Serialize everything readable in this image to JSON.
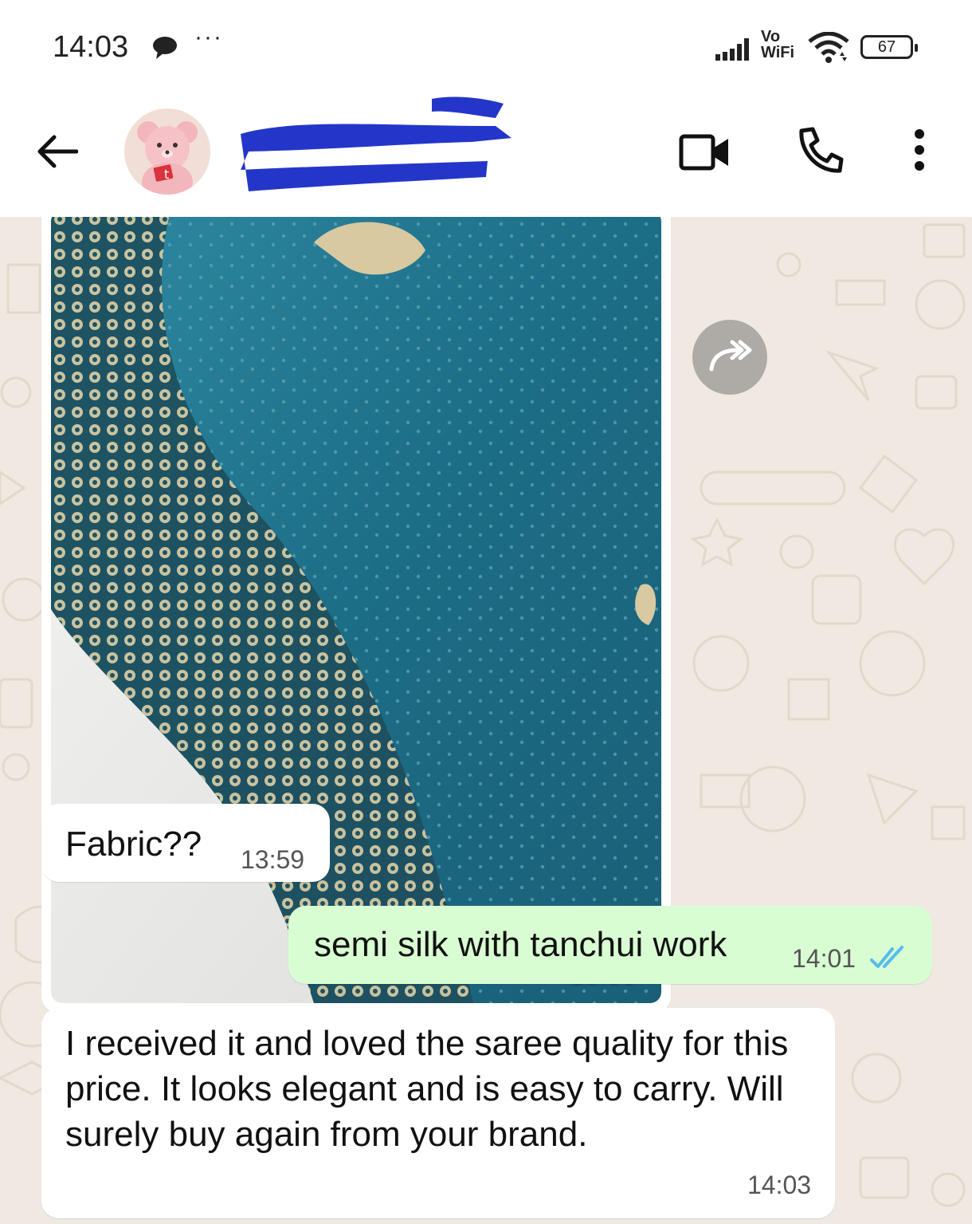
{
  "status_bar": {
    "time": "14:03",
    "more": "···",
    "network_label_top": "Vo",
    "network_label_bottom": "WiFi",
    "battery": "67"
  },
  "header": {
    "contact_name": "",
    "icons": [
      "back-arrow-icon",
      "video-call-icon",
      "phone-call-icon",
      "more-vert-icon"
    ]
  },
  "messages": [
    {
      "type": "image",
      "direction": "incoming",
      "time": "13:59"
    },
    {
      "type": "text",
      "direction": "incoming",
      "text": "Fabric??",
      "time": "13:59"
    },
    {
      "type": "text",
      "direction": "outgoing",
      "text": "semi silk with tanchui work",
      "time": "14:01",
      "status": "read"
    },
    {
      "type": "text",
      "direction": "incoming",
      "text": "I received it and loved the saree quality for this price. It looks elegant and is easy to carry. Will surely buy again from your brand.",
      "time": "14:03"
    }
  ],
  "colors": {
    "outgoing_bubble": "#d9fdd3",
    "incoming_bubble": "#ffffff",
    "chat_background": "#efe9e1",
    "read_ticks": "#53bdeb",
    "redaction": "#2436c9"
  }
}
